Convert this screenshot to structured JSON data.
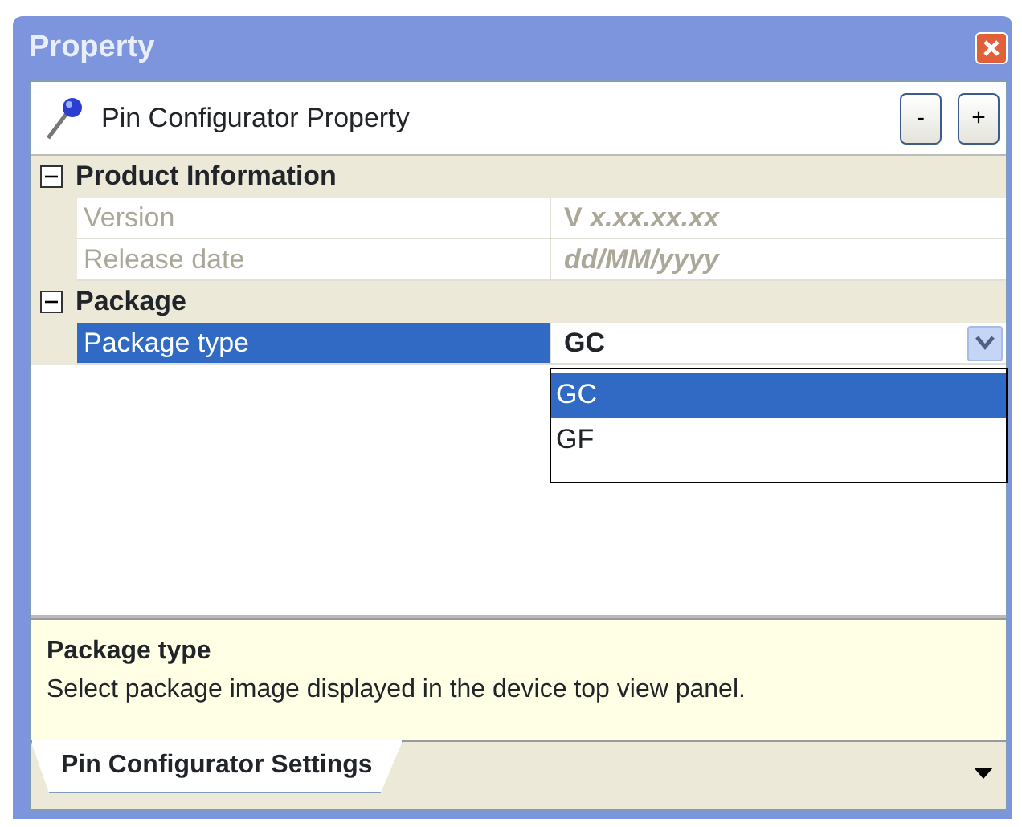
{
  "window": {
    "title": "Property"
  },
  "header": {
    "title": "Pin Configurator Property",
    "buttons": [
      "-",
      "+"
    ]
  },
  "categories": [
    {
      "label": "Product Information",
      "expanded": true,
      "properties": [
        {
          "name": "Version",
          "value": "V *x.xx.xx.xx*",
          "italic": false,
          "disabled": true,
          "selected": false
        },
        {
          "name": "Release date",
          "value": "dd/MM/yyyy",
          "italic": true,
          "disabled": true,
          "selected": false
        }
      ]
    },
    {
      "label": "Package",
      "expanded": true,
      "properties": [
        {
          "name": "Package type",
          "value": "GC",
          "disabled": false,
          "selected": true,
          "dropdown": {
            "options": [
              {
                "label": "GC",
                "selected": true
              },
              {
                "label": "GF",
                "selected": false
              }
            ]
          }
        }
      ]
    }
  ],
  "description": {
    "title": "Package type",
    "text": "Select package image displayed in the device top view panel."
  },
  "tabs": [
    {
      "label": "Pin Configurator Settings",
      "selected": true
    }
  ]
}
